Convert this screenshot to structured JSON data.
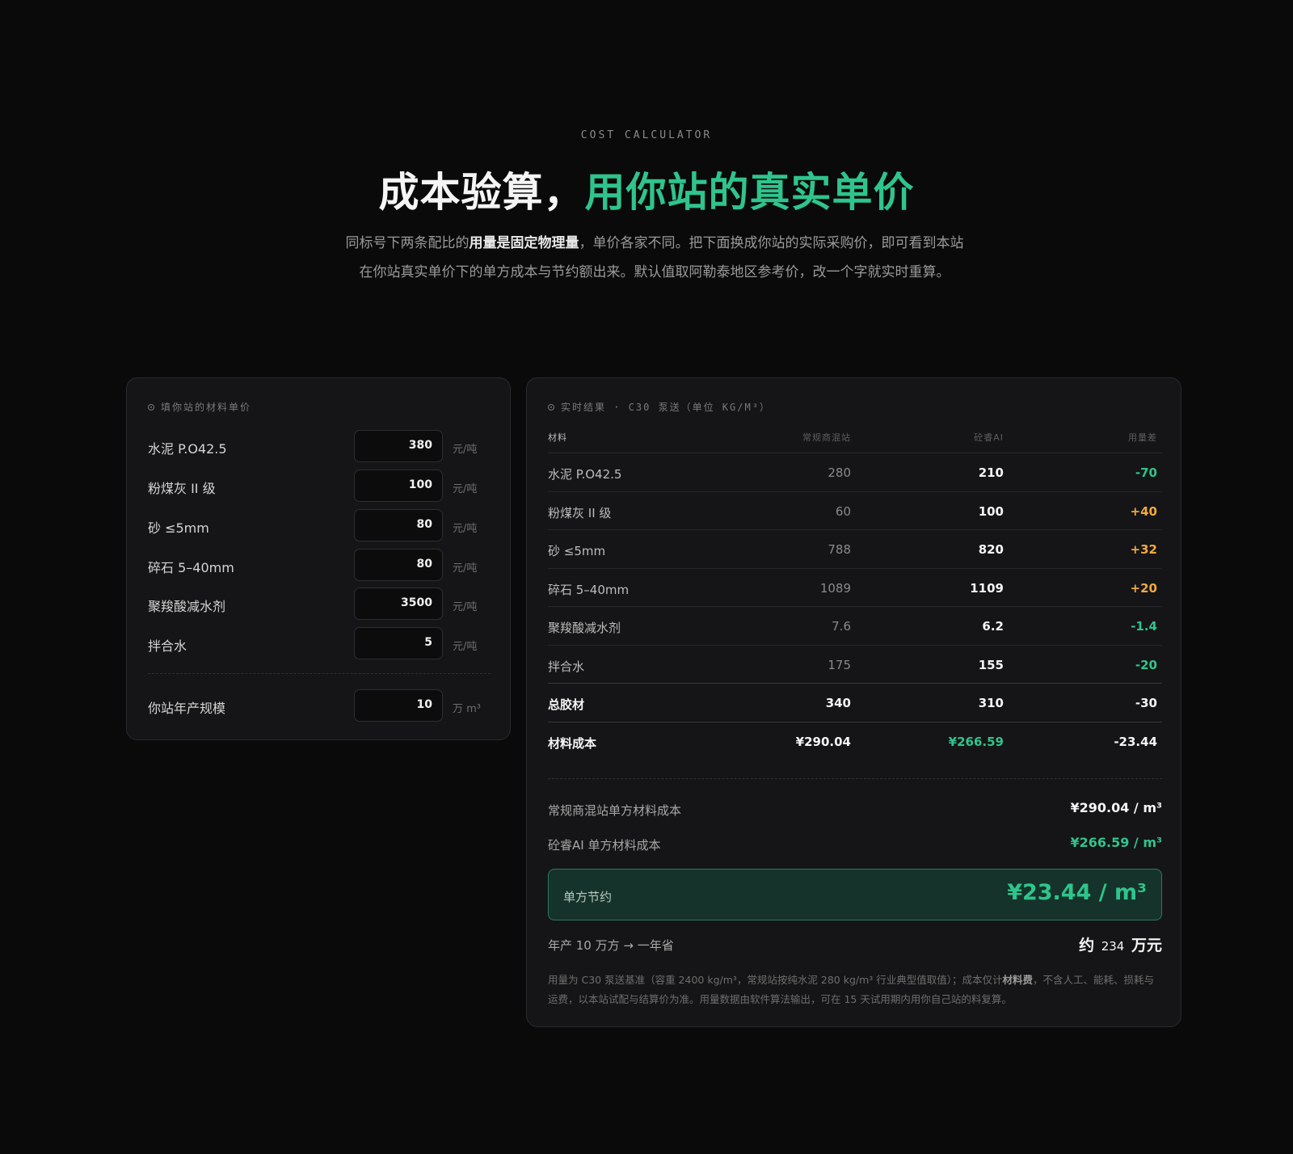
{
  "header": {
    "eyebrow": "COST CALCULATOR",
    "title_main": "成本验算，",
    "title_accent": "用你站的真实单价",
    "desc_pre": "同标号下两条配比的",
    "desc_bold": "用量是固定物理量",
    "desc_post": "，单价各家不同。把下面换成你站的实际采购价，即可看到本站在你站真实单价下的单方成本与节约额出来。默认值取阿勒泰地区参考价，改一个字就实时重算。"
  },
  "left": {
    "label": "填你站的材料单价",
    "items": [
      {
        "name": "水泥 P.O42.5",
        "value": "380",
        "unit": "元/吨"
      },
      {
        "name": "粉煤灰 II 级",
        "value": "100",
        "unit": "元/吨"
      },
      {
        "name": "砂 ≤5mm",
        "value": "80",
        "unit": "元/吨"
      },
      {
        "name": "碎石 5–40mm",
        "value": "80",
        "unit": "元/吨"
      },
      {
        "name": "聚羧酸减水剂",
        "value": "3500",
        "unit": "元/吨"
      },
      {
        "name": "拌合水",
        "value": "5",
        "unit": "元/吨"
      }
    ],
    "scale": {
      "name": "你站年产规模",
      "value": "10",
      "unit": "万 m³"
    }
  },
  "right": {
    "label": "实时结果 · C30 泵送（单位 KG/M³）",
    "headers": [
      "材料",
      "常规商混站",
      "砼睿AI",
      "用量差"
    ],
    "rows": [
      {
        "name": "水泥 P.O42.5",
        "base": "280",
        "ai": "210",
        "diff": "-70"
      },
      {
        "name": "粉煤灰 II 级",
        "base": "60",
        "ai": "100",
        "diff": "+40"
      },
      {
        "name": "砂 ≤5mm",
        "base": "788",
        "ai": "820",
        "diff": "+32"
      },
      {
        "name": "碎石 5–40mm",
        "base": "1089",
        "ai": "1109",
        "diff": "+20"
      },
      {
        "name": "聚羧酸减水剂",
        "base": "7.6",
        "ai": "6.2",
        "diff": "-1.4"
      },
      {
        "name": "拌合水",
        "base": "175",
        "ai": "155",
        "diff": "-20"
      },
      {
        "name": "总胶材",
        "base": "340",
        "ai": "310",
        "diff": "-30"
      },
      {
        "name": "材料成本",
        "base": "¥290.04",
        "ai": "¥266.59",
        "diff": "-23.44"
      }
    ],
    "summary": {
      "base_label": "常规商混站单方材料成本",
      "base_value": "¥290.04 / m³",
      "ai_label": "砼睿AI 单方材料成本",
      "ai_value": "¥266.59 / m³",
      "save_label": "单方节约",
      "save_value": "¥23.44 / m³",
      "year_label": "年产 10 万方 → 一年省",
      "year_prefix": "约",
      "year_num": "234",
      "year_suffix": "万元"
    },
    "footnote_pre": "用量为 C30 泵送基准（容重 2400 kg/m³，常规站按纯水泥 280 kg/m³ 行业典型值取值）；成本仅计",
    "footnote_bold": "材料费",
    "footnote_post": "，不含人工、能耗、损耗与运费，以本站试配与结算价为准。用量数据由软件算法输出，可在 15 天试用期内用你自己站的料复算。"
  },
  "colors": {
    "accent": "#2fc48d",
    "increase": "#f0a840",
    "background": "#0a0a0a",
    "card": "#151517"
  }
}
